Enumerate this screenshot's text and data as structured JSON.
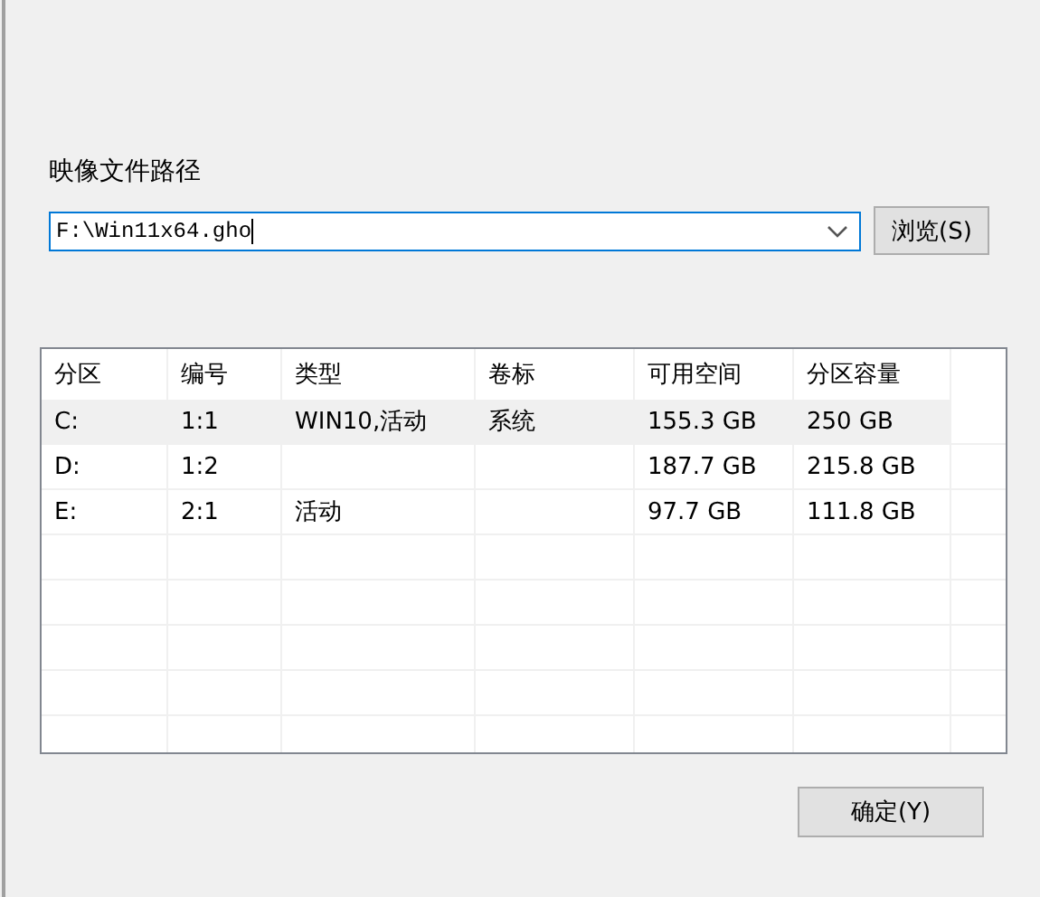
{
  "image_path": {
    "label": "映像文件路径",
    "value": "F:\\Win11x64.gho",
    "browse_button": "浏览(S)"
  },
  "partitions": {
    "columns": [
      "分区",
      "编号",
      "类型",
      "卷标",
      "可用空间",
      "分区容量"
    ],
    "rows": [
      {
        "cells": [
          "C:",
          "1:1",
          "WIN10,活动",
          "系统",
          "155.3 GB",
          "250 GB"
        ],
        "selected": true
      },
      {
        "cells": [
          "D:",
          "1:2",
          "",
          "",
          "187.7 GB",
          "215.8 GB"
        ],
        "selected": false
      },
      {
        "cells": [
          "E:",
          "2:1",
          "活动",
          "",
          "97.7 GB",
          "111.8 GB"
        ],
        "selected": false
      }
    ]
  },
  "buttons": [
    "确定(Y)"
  ]
}
